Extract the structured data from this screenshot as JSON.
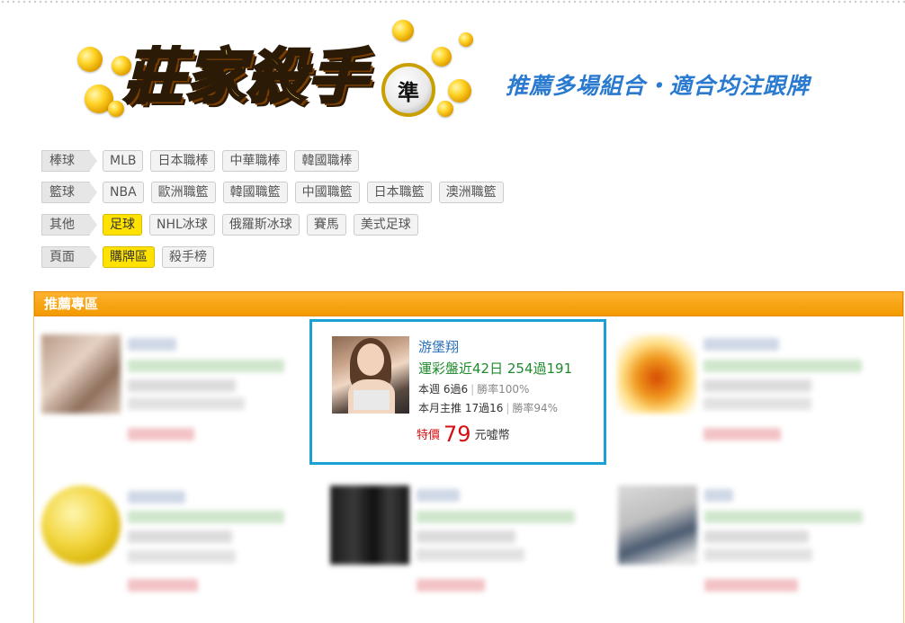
{
  "banner": {
    "logo_text": "莊家殺手",
    "logo_badge": "準",
    "slogan": "推薦多場組合・適合均注跟牌"
  },
  "categories": [
    {
      "label": "棒球",
      "items": [
        {
          "label": "MLB",
          "active": false
        },
        {
          "label": "日本職棒",
          "active": false
        },
        {
          "label": "中華職棒",
          "active": false
        },
        {
          "label": "韓國職棒",
          "active": false
        }
      ]
    },
    {
      "label": "籃球",
      "items": [
        {
          "label": "NBA",
          "active": false
        },
        {
          "label": "歐洲職籃",
          "active": false
        },
        {
          "label": "韓國職籃",
          "active": false
        },
        {
          "label": "中國職籃",
          "active": false
        },
        {
          "label": "日本職籃",
          "active": false
        },
        {
          "label": "澳洲職籃",
          "active": false
        }
      ]
    },
    {
      "label": "其他",
      "items": [
        {
          "label": "足球",
          "active": true
        },
        {
          "label": "NHL冰球",
          "active": false
        },
        {
          "label": "俄羅斯冰球",
          "active": false
        },
        {
          "label": "賽馬",
          "active": false
        },
        {
          "label": "美式足球",
          "active": false
        }
      ]
    },
    {
      "label": "頁面",
      "items": [
        {
          "label": "購牌區",
          "active": true
        },
        {
          "label": "殺手榜",
          "active": false
        }
      ]
    }
  ],
  "panel": {
    "title": "推薦專區"
  },
  "featured": {
    "name": "游堡翔",
    "record": "運彩盤近42日 254過191",
    "week": "本週 6過6",
    "week_rate": "勝率100%",
    "month": "本月主推 17過16",
    "month_rate": "勝率94%",
    "price_label": "特價",
    "price": "79",
    "price_unit": "元噓幣"
  },
  "colors": {
    "accent_orange": "#f29a00",
    "active_chip": "#ffe200",
    "featured_border": "#1aa0d4",
    "price_red": "#d41010",
    "record_green": "#1f8a2b",
    "name_blue": "#2a6fb8"
  }
}
